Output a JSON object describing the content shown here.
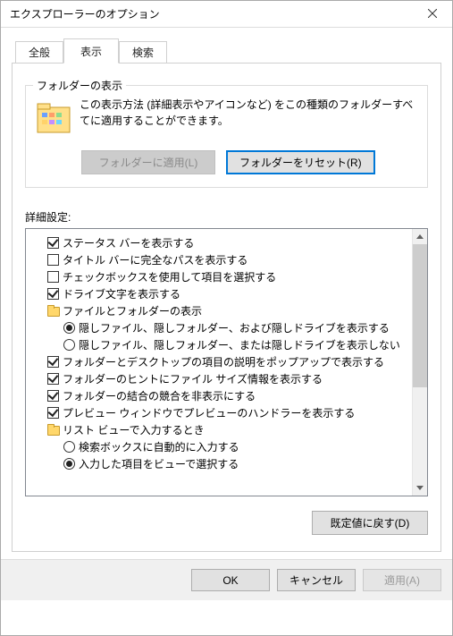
{
  "window": {
    "title": "エクスプローラーのオプション"
  },
  "tabs": {
    "general": "全般",
    "view": "表示",
    "search": "検索"
  },
  "folderViews": {
    "legend": "フォルダーの表示",
    "description": "この表示方法 (詳細表示やアイコンなど) をこの種類のフォルダーすべてに適用することができます。",
    "applyButton": "フォルダーに適用(L)",
    "resetButton": "フォルダーをリセット(R)"
  },
  "advanced": {
    "label": "詳細設定:",
    "items": [
      {
        "type": "checkbox",
        "checked": true,
        "indent": 0,
        "label": "ステータス バーを表示する"
      },
      {
        "type": "checkbox",
        "checked": false,
        "indent": 0,
        "label": "タイトル バーに完全なパスを表示する"
      },
      {
        "type": "checkbox",
        "checked": false,
        "indent": 0,
        "label": "チェックボックスを使用して項目を選択する"
      },
      {
        "type": "checkbox",
        "checked": true,
        "indent": 0,
        "label": "ドライブ文字を表示する"
      },
      {
        "type": "folder",
        "checked": false,
        "indent": 0,
        "label": "ファイルとフォルダーの表示"
      },
      {
        "type": "radio",
        "checked": true,
        "indent": 1,
        "label": "隠しファイル、隠しフォルダー、および隠しドライブを表示する"
      },
      {
        "type": "radio",
        "checked": false,
        "indent": 1,
        "label": "隠しファイル、隠しフォルダー、または隠しドライブを表示しない"
      },
      {
        "type": "checkbox",
        "checked": true,
        "indent": 0,
        "label": "フォルダーとデスクトップの項目の説明をポップアップで表示する"
      },
      {
        "type": "checkbox",
        "checked": true,
        "indent": 0,
        "label": "フォルダーのヒントにファイル サイズ情報を表示する"
      },
      {
        "type": "checkbox",
        "checked": true,
        "indent": 0,
        "label": "フォルダーの結合の競合を非表示にする"
      },
      {
        "type": "checkbox",
        "checked": true,
        "indent": 0,
        "label": "プレビュー ウィンドウでプレビューのハンドラーを表示する"
      },
      {
        "type": "folder",
        "checked": false,
        "indent": 0,
        "label": "リスト ビューで入力するとき"
      },
      {
        "type": "radio",
        "checked": false,
        "indent": 1,
        "label": "検索ボックスに自動的に入力する"
      },
      {
        "type": "radio",
        "checked": true,
        "indent": 1,
        "label": "入力した項目をビューで選択する"
      }
    ],
    "restoreDefaults": "既定値に戻す(D)"
  },
  "dialogButtons": {
    "ok": "OK",
    "cancel": "キャンセル",
    "apply": "適用(A)"
  }
}
